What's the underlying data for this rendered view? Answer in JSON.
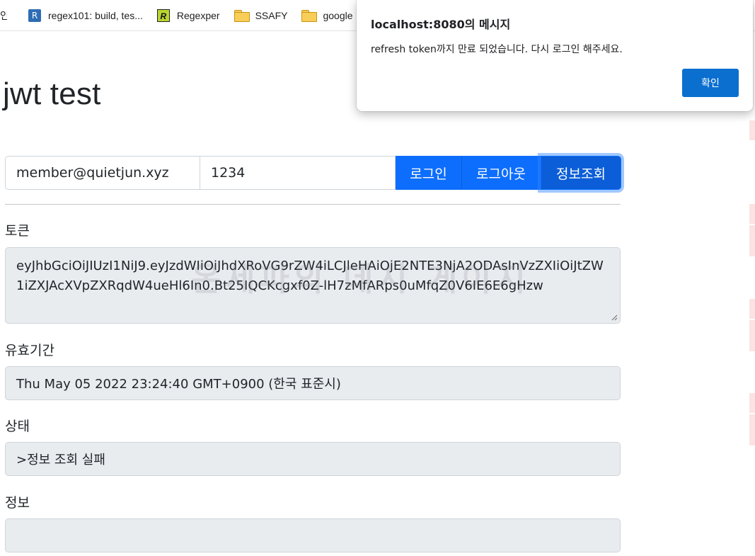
{
  "bookmarks": [
    {
      "label": "인",
      "icon": "partial"
    },
    {
      "label": "regex101: build, tes...",
      "icon": "regex101-icon",
      "glyph": "R"
    },
    {
      "label": "Regexper",
      "icon": "regexper-icon",
      "glyph": "R"
    },
    {
      "label": "SSAFY",
      "icon": "folder-icon"
    },
    {
      "label": "google",
      "icon": "folder-icon"
    }
  ],
  "page": {
    "title": "jwt test",
    "email_value": "member@quietjun.xyz",
    "password_value": "1234",
    "login_button": "로그인",
    "logout_button": "로그아웃",
    "info_button": "정보조회",
    "token_label": "토큰",
    "token_value": "eyJhbGciOiJIUzI1NiJ9.eyJzdWIiOiJhdXRoVG9rZW4iLCJleHAiOjE2NTE3NjA2ODAsInVzZXIiOiJtZW1iZXJAcXVpZXRqdW4ueHl6In0.Bt25IQCKcgxf0Z-lH7zMfARps0uMfqZ0V6IE6E6gHzw",
    "expiry_label": "유효기간",
    "expiry_value": "Thu May 05 2022 23:24:40 GMT+0900 (한국 표준시)",
    "status_label": "상태",
    "status_value": ">정보 조회 실패",
    "info_label": "정보",
    "info_value": "",
    "watermark": "온세파의 데시 게이지"
  },
  "dialog": {
    "title": "localhost:8080의 메시지",
    "message": "refresh token까지 만료 되었습니다. 다시 로그인 해주세요.",
    "ok_button": "확인"
  },
  "colors": {
    "primary": "#0d6efd",
    "primary_active": "#0b5ed7",
    "readonly_bg": "#e9ecef",
    "dialog_button": "#0b6fd0"
  }
}
